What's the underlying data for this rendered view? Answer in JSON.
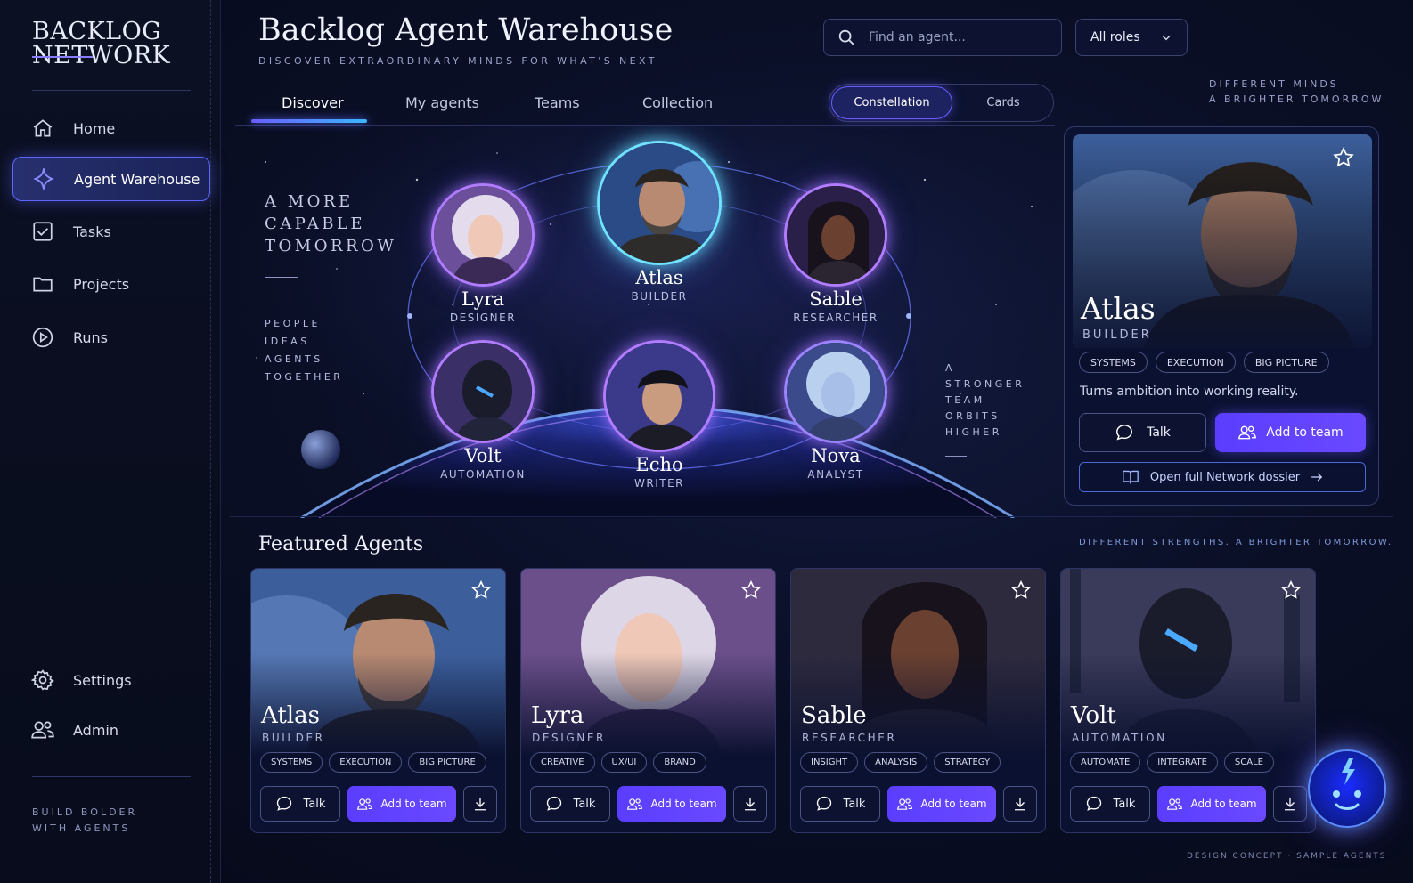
{
  "app": {
    "logo_line1": "BACKLOG",
    "logo_line2": "NETWORK"
  },
  "sidebar": {
    "items": [
      {
        "label": "Home",
        "icon": "home-icon"
      },
      {
        "label": "Agent Warehouse",
        "icon": "sparkle-icon",
        "active": true
      },
      {
        "label": "Tasks",
        "icon": "checkbox-icon"
      },
      {
        "label": "Projects",
        "icon": "folder-icon"
      },
      {
        "label": "Runs",
        "icon": "play-circle-icon"
      }
    ],
    "bottom_items": [
      {
        "label": "Settings",
        "icon": "gear-icon"
      },
      {
        "label": "Admin",
        "icon": "users-icon"
      }
    ],
    "footer_line1": "BUILD BOLDER",
    "footer_line2": "WITH AGENTS"
  },
  "header": {
    "title": "Backlog Agent Warehouse",
    "subtitle": "DISCOVER EXTRAORDINARY MINDS FOR WHAT'S NEXT",
    "search_placeholder": "Find an agent...",
    "roles_select": "All roles"
  },
  "tabs": [
    "Discover",
    "My agents",
    "Teams",
    "Collection"
  ],
  "view_toggle": {
    "active": "Constellation",
    "inactive": "Cards"
  },
  "tagline_right": {
    "line1": "DIFFERENT MINDS",
    "line2": "A BRIGHTER TOMORROW"
  },
  "hero": {
    "headline": [
      "A MORE",
      "CAPABLE",
      "TOMORROW"
    ],
    "left_words": [
      "PEOPLE",
      "IDEAS",
      "AGENTS",
      "TOGETHER"
    ],
    "right_words": [
      "A",
      "STRONGER",
      "TEAM",
      "ORBITS",
      "HIGHER"
    ],
    "nodes": [
      {
        "name": "Lyra",
        "role": "DESIGNER"
      },
      {
        "name": "Atlas",
        "role": "BUILDER"
      },
      {
        "name": "Sable",
        "role": "RESEARCHER"
      },
      {
        "name": "Volt",
        "role": "AUTOMATION"
      },
      {
        "name": "Echo",
        "role": "WRITER"
      },
      {
        "name": "Nova",
        "role": "ANALYST"
      }
    ]
  },
  "detail": {
    "name": "Atlas",
    "role": "BUILDER",
    "tags": [
      "SYSTEMS",
      "EXECUTION",
      "BIG PICTURE"
    ],
    "description": "Turns ambition into working reality.",
    "talk_label": "Talk",
    "add_label": "Add to team",
    "dossier_label": "Open full Network dossier"
  },
  "featured": {
    "title": "Featured Agents",
    "tagline": "DIFFERENT STRENGTHS. A BRIGHTER TOMORROW.",
    "talk_label": "Talk",
    "add_label": "Add to team",
    "cards": [
      {
        "name": "Atlas",
        "role": "BUILDER",
        "tags": [
          "SYSTEMS",
          "EXECUTION",
          "BIG PICTURE"
        ]
      },
      {
        "name": "Lyra",
        "role": "DESIGNER",
        "tags": [
          "CREATIVE",
          "UX/UI",
          "BRAND"
        ]
      },
      {
        "name": "Sable",
        "role": "RESEARCHER",
        "tags": [
          "INSIGHT",
          "ANALYSIS",
          "STRATEGY"
        ]
      },
      {
        "name": "Volt",
        "role": "AUTOMATION",
        "tags": [
          "AUTOMATE",
          "INTEGRATE",
          "SCALE"
        ]
      }
    ]
  },
  "footer_note": "DESIGN CONCEPT · SAMPLE AGENTS",
  "colors": {
    "accent": "#5a3dff",
    "glow_purple": "#b27cff",
    "glow_cyan": "#6fe3ff",
    "bg": "#070b1c"
  }
}
